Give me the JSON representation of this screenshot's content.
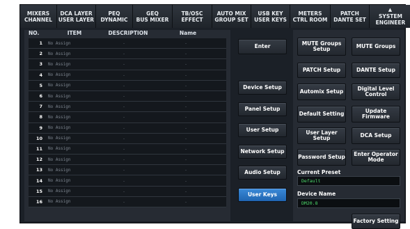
{
  "tabs": [
    {
      "l1": "MIXERS",
      "l2": "CHANNEL"
    },
    {
      "l1": "DCA LAYER",
      "l2": "USER LAYER"
    },
    {
      "l1": "PEQ",
      "l2": "DYNAMIC"
    },
    {
      "l1": "GEQ",
      "l2": "BUS MIXER"
    },
    {
      "l1": "TB/OSC",
      "l2": "EFFECT"
    },
    {
      "l1": "AUTO MIX",
      "l2": "GROUP SET"
    },
    {
      "l1": "USB KEY",
      "l2": "USER KEYS"
    },
    {
      "l1": "METERS",
      "l2": "CTRL ROOM"
    },
    {
      "l1": "PATCH",
      "l2": "DANTE SET"
    },
    {
      "l1": "SYSTEM",
      "l2": "ENGINEER",
      "icon": "lock-icon"
    }
  ],
  "table": {
    "headers": {
      "no": "NO.",
      "item": "ITEM",
      "description": "DESCRIPTION",
      "name": "Name"
    },
    "rows": [
      {
        "no": "1",
        "item": "No Assign",
        "description": "-",
        "name": "-"
      },
      {
        "no": "2",
        "item": "No Assign",
        "description": "-",
        "name": "-"
      },
      {
        "no": "3",
        "item": "No Assign",
        "description": "-",
        "name": "-"
      },
      {
        "no": "4",
        "item": "No Assign",
        "description": "-",
        "name": "-"
      },
      {
        "no": "5",
        "item": "No Assign",
        "description": "-",
        "name": "-"
      },
      {
        "no": "6",
        "item": "No Assign",
        "description": "-",
        "name": "-"
      },
      {
        "no": "7",
        "item": "No Assign",
        "description": "-",
        "name": "-"
      },
      {
        "no": "8",
        "item": "No Assign",
        "description": "-",
        "name": "-"
      },
      {
        "no": "9",
        "item": "No Assign",
        "description": "-",
        "name": "-"
      },
      {
        "no": "10",
        "item": "No Assign",
        "description": "-",
        "name": "-"
      },
      {
        "no": "11",
        "item": "No Assign",
        "description": "-",
        "name": "-"
      },
      {
        "no": "12",
        "item": "No Assign",
        "description": "-",
        "name": "-"
      },
      {
        "no": "13",
        "item": "No Assign",
        "description": "-",
        "name": "-"
      },
      {
        "no": "14",
        "item": "No Assign",
        "description": "-",
        "name": "-"
      },
      {
        "no": "15",
        "item": "No Assign",
        "description": "-",
        "name": "-"
      },
      {
        "no": "16",
        "item": "No Assign",
        "description": "-",
        "name": "-"
      }
    ]
  },
  "middle_buttons": {
    "enter": "Enter",
    "device_setup": "Device Setup",
    "panel_setup": "Panel Setup",
    "user_setup": "User Setup",
    "network_setup": "Network Setup",
    "audio_setup": "Audio Setup",
    "user_keys": "User Keys"
  },
  "right_buttons": {
    "mute_groups_setup": "MUTE Groups Setup",
    "mute_groups": "MUTE Groups",
    "patch_setup": "PATCH Setup",
    "dante_setup": "DANTE Setup",
    "automix_setup": "Automix Setup",
    "digital_level_control": "Digital Level Control",
    "default_setting": "Default Setting",
    "update_firmware": "Update Firmware",
    "user_layer_setup": "User Layer Setup",
    "dca_setup": "DCA Setup",
    "password_setup": "Password Setup",
    "enter_operator_mode": "Enter Operator Mode",
    "factory_setting": "Factory Setting"
  },
  "current_preset": {
    "label": "Current Preset",
    "value": "Default"
  },
  "device_name": {
    "label": "Device Name",
    "value": "DM20.8"
  },
  "colors": {
    "active_button": "#2a78c8",
    "field_text": "#4cd96a",
    "background": "#1b2027"
  }
}
